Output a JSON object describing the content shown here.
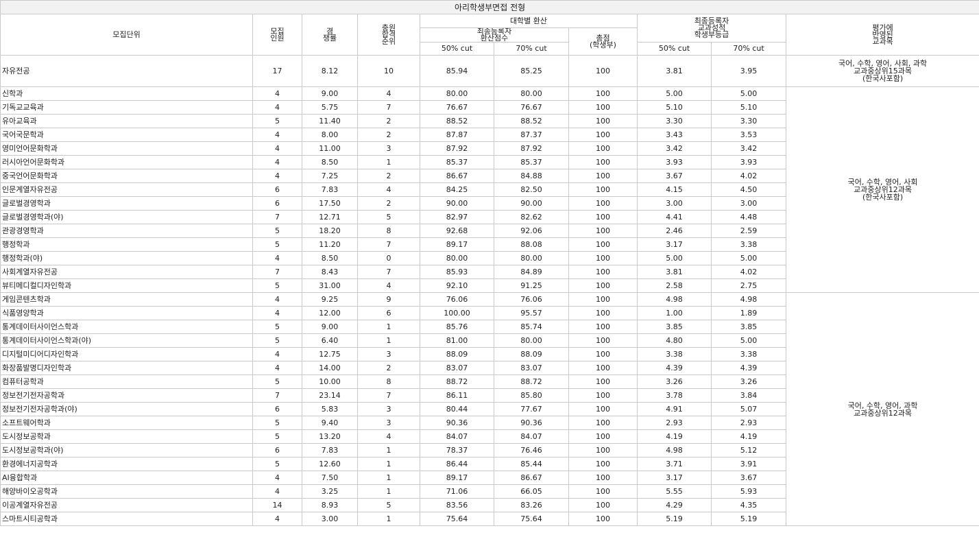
{
  "table": {
    "title": "아리학생부면접 전형",
    "headers": {
      "unit": "모집단위",
      "quota_line1": "모집",
      "quota_line2": "인원",
      "ratio_line1": "경",
      "ratio_line2": "쟁률",
      "rank_line1": "충원",
      "rank_line2": "합격",
      "rank_line3": "순위",
      "univ_conv": "대학별 환산",
      "final_conv_line1": "최종등록자",
      "final_conv_line2": "환산점수",
      "total_line1": "총점",
      "total_line2": "(학생부)",
      "final_grade_line1": "최종등록자",
      "final_grade_line2": "교과성적",
      "final_grade_line3": "학생부등급",
      "eval_line1": "평가에",
      "eval_line2": "반영된",
      "eval_line3": "교과목",
      "cut50_a": "50% cut",
      "cut70_a": "70% cut",
      "cut50_b": "50% cut",
      "cut70_b": "70% cut"
    },
    "subject_groups": [
      {
        "line1": "국어, 수학, 영어, 사회, 과학",
        "line2": "교과중상위15과목",
        "line3": "(한국사포함)"
      },
      {
        "line1": "국어, 수학, 영어, 사회",
        "line2": "교과중상위12과목",
        "line3": "(한국사포함)"
      },
      {
        "line1": "국어, 수학, 영어, 과학",
        "line2": "교과중상위12과목",
        "line3": ""
      }
    ],
    "rows": [
      {
        "unit": "자유전공",
        "quota": "17",
        "ratio": "8.12",
        "rank": "10",
        "conv50": "85.94",
        "conv70": "85.25",
        "total": "100",
        "grade50": "3.81",
        "grade70": "3.95"
      },
      {
        "unit": "신학과",
        "quota": "4",
        "ratio": "9.00",
        "rank": "4",
        "conv50": "80.00",
        "conv70": "80.00",
        "total": "100",
        "grade50": "5.00",
        "grade70": "5.00"
      },
      {
        "unit": "기독교교육과",
        "quota": "4",
        "ratio": "5.75",
        "rank": "7",
        "conv50": "76.67",
        "conv70": "76.67",
        "total": "100",
        "grade50": "5.10",
        "grade70": "5.10"
      },
      {
        "unit": "유아교육과",
        "quota": "5",
        "ratio": "11.40",
        "rank": "2",
        "conv50": "88.52",
        "conv70": "88.52",
        "total": "100",
        "grade50": "3.30",
        "grade70": "3.30"
      },
      {
        "unit": "국어국문학과",
        "quota": "4",
        "ratio": "8.00",
        "rank": "2",
        "conv50": "87.87",
        "conv70": "87.37",
        "total": "100",
        "grade50": "3.43",
        "grade70": "3.53"
      },
      {
        "unit": "영미언어문화학과",
        "quota": "4",
        "ratio": "11.00",
        "rank": "3",
        "conv50": "87.92",
        "conv70": "87.92",
        "total": "100",
        "grade50": "3.42",
        "grade70": "3.42"
      },
      {
        "unit": "러시아언어문화학과",
        "quota": "4",
        "ratio": "8.50",
        "rank": "1",
        "conv50": "85.37",
        "conv70": "85.37",
        "total": "100",
        "grade50": "3.93",
        "grade70": "3.93"
      },
      {
        "unit": "중국언어문화학과",
        "quota": "4",
        "ratio": "7.25",
        "rank": "2",
        "conv50": "86.67",
        "conv70": "84.88",
        "total": "100",
        "grade50": "3.67",
        "grade70": "4.02"
      },
      {
        "unit": "인문계열자유전공",
        "quota": "6",
        "ratio": "7.83",
        "rank": "4",
        "conv50": "84.25",
        "conv70": "82.50",
        "total": "100",
        "grade50": "4.15",
        "grade70": "4.50"
      },
      {
        "unit": "글로벌경영학과",
        "quota": "6",
        "ratio": "17.50",
        "rank": "2",
        "conv50": "90.00",
        "conv70": "90.00",
        "total": "100",
        "grade50": "3.00",
        "grade70": "3.00"
      },
      {
        "unit": "글로벌경영학과(야)",
        "quota": "7",
        "ratio": "12.71",
        "rank": "5",
        "conv50": "82.97",
        "conv70": "82.62",
        "total": "100",
        "grade50": "4.41",
        "grade70": "4.48"
      },
      {
        "unit": "관광경영학과",
        "quota": "5",
        "ratio": "18.20",
        "rank": "8",
        "conv50": "92.68",
        "conv70": "92.06",
        "total": "100",
        "grade50": "2.46",
        "grade70": "2.59"
      },
      {
        "unit": "행정학과",
        "quota": "5",
        "ratio": "11.20",
        "rank": "7",
        "conv50": "89.17",
        "conv70": "88.08",
        "total": "100",
        "grade50": "3.17",
        "grade70": "3.38"
      },
      {
        "unit": "행정학과(야)",
        "quota": "4",
        "ratio": "8.50",
        "rank": "0",
        "conv50": "80.00",
        "conv70": "80.00",
        "total": "100",
        "grade50": "5.00",
        "grade70": "5.00"
      },
      {
        "unit": "사회계열자유전공",
        "quota": "7",
        "ratio": "8.43",
        "rank": "7",
        "conv50": "85.93",
        "conv70": "84.89",
        "total": "100",
        "grade50": "3.81",
        "grade70": "4.02"
      },
      {
        "unit": "뷰티메디컬디자인학과",
        "quota": "5",
        "ratio": "31.00",
        "rank": "4",
        "conv50": "92.10",
        "conv70": "91.25",
        "total": "100",
        "grade50": "2.58",
        "grade70": "2.75"
      },
      {
        "unit": "게임콘텐츠학과",
        "quota": "4",
        "ratio": "9.25",
        "rank": "9",
        "conv50": "76.06",
        "conv70": "76.06",
        "total": "100",
        "grade50": "4.98",
        "grade70": "4.98"
      },
      {
        "unit": "식품영양학과",
        "quota": "4",
        "ratio": "12.00",
        "rank": "6",
        "conv50": "100.00",
        "conv70": "95.57",
        "total": "100",
        "grade50": "1.00",
        "grade70": "1.89"
      },
      {
        "unit": "통계데이터사이언스학과",
        "quota": "5",
        "ratio": "9.00",
        "rank": "1",
        "conv50": "85.76",
        "conv70": "85.74",
        "total": "100",
        "grade50": "3.85",
        "grade70": "3.85"
      },
      {
        "unit": "통계데이터사이언스학과(야)",
        "quota": "5",
        "ratio": "6.40",
        "rank": "1",
        "conv50": "81.00",
        "conv70": "80.00",
        "total": "100",
        "grade50": "4.80",
        "grade70": "5.00"
      },
      {
        "unit": "디지털미디어디자인학과",
        "quota": "4",
        "ratio": "12.75",
        "rank": "3",
        "conv50": "88.09",
        "conv70": "88.09",
        "total": "100",
        "grade50": "3.38",
        "grade70": "3.38"
      },
      {
        "unit": "화장품발명디자인학과",
        "quota": "4",
        "ratio": "14.00",
        "rank": "2",
        "conv50": "83.07",
        "conv70": "83.07",
        "total": "100",
        "grade50": "4.39",
        "grade70": "4.39"
      },
      {
        "unit": "컴퓨터공학과",
        "quota": "5",
        "ratio": "10.00",
        "rank": "8",
        "conv50": "88.72",
        "conv70": "88.72",
        "total": "100",
        "grade50": "3.26",
        "grade70": "3.26"
      },
      {
        "unit": "정보전기전자공학과",
        "quota": "7",
        "ratio": "23.14",
        "rank": "7",
        "conv50": "86.11",
        "conv70": "85.80",
        "total": "100",
        "grade50": "3.78",
        "grade70": "3.84"
      },
      {
        "unit": "정보전기전자공학과(야)",
        "quota": "6",
        "ratio": "5.83",
        "rank": "3",
        "conv50": "80.44",
        "conv70": "77.67",
        "total": "100",
        "grade50": "4.91",
        "grade70": "5.07"
      },
      {
        "unit": "소프트웨어학과",
        "quota": "5",
        "ratio": "9.40",
        "rank": "3",
        "conv50": "90.36",
        "conv70": "90.36",
        "total": "100",
        "grade50": "2.93",
        "grade70": "2.93"
      },
      {
        "unit": "도시정보공학과",
        "quota": "5",
        "ratio": "13.20",
        "rank": "4",
        "conv50": "84.07",
        "conv70": "84.07",
        "total": "100",
        "grade50": "4.19",
        "grade70": "4.19"
      },
      {
        "unit": "도시정보공학과(야)",
        "quota": "6",
        "ratio": "7.83",
        "rank": "1",
        "conv50": "78.37",
        "conv70": "76.46",
        "total": "100",
        "grade50": "4.98",
        "grade70": "5.12"
      },
      {
        "unit": "환경에너지공학과",
        "quota": "5",
        "ratio": "12.60",
        "rank": "1",
        "conv50": "86.44",
        "conv70": "85.44",
        "total": "100",
        "grade50": "3.71",
        "grade70": "3.91"
      },
      {
        "unit": "AI융합학과",
        "quota": "4",
        "ratio": "7.50",
        "rank": "1",
        "conv50": "89.17",
        "conv70": "86.67",
        "total": "100",
        "grade50": "3.17",
        "grade70": "3.67"
      },
      {
        "unit": "해양바이오공학과",
        "quota": "4",
        "ratio": "3.25",
        "rank": "1",
        "conv50": "71.06",
        "conv70": "66.05",
        "total": "100",
        "grade50": "5.55",
        "grade70": "5.93"
      },
      {
        "unit": "이공계열자유전공",
        "quota": "14",
        "ratio": "8.93",
        "rank": "5",
        "conv50": "83.56",
        "conv70": "83.26",
        "total": "100",
        "grade50": "4.29",
        "grade70": "4.35"
      },
      {
        "unit": "스마트시티공학과",
        "quota": "4",
        "ratio": "3.00",
        "rank": "1",
        "conv50": "75.64",
        "conv70": "75.64",
        "total": "100",
        "grade50": "5.19",
        "grade70": "5.19"
      }
    ]
  }
}
